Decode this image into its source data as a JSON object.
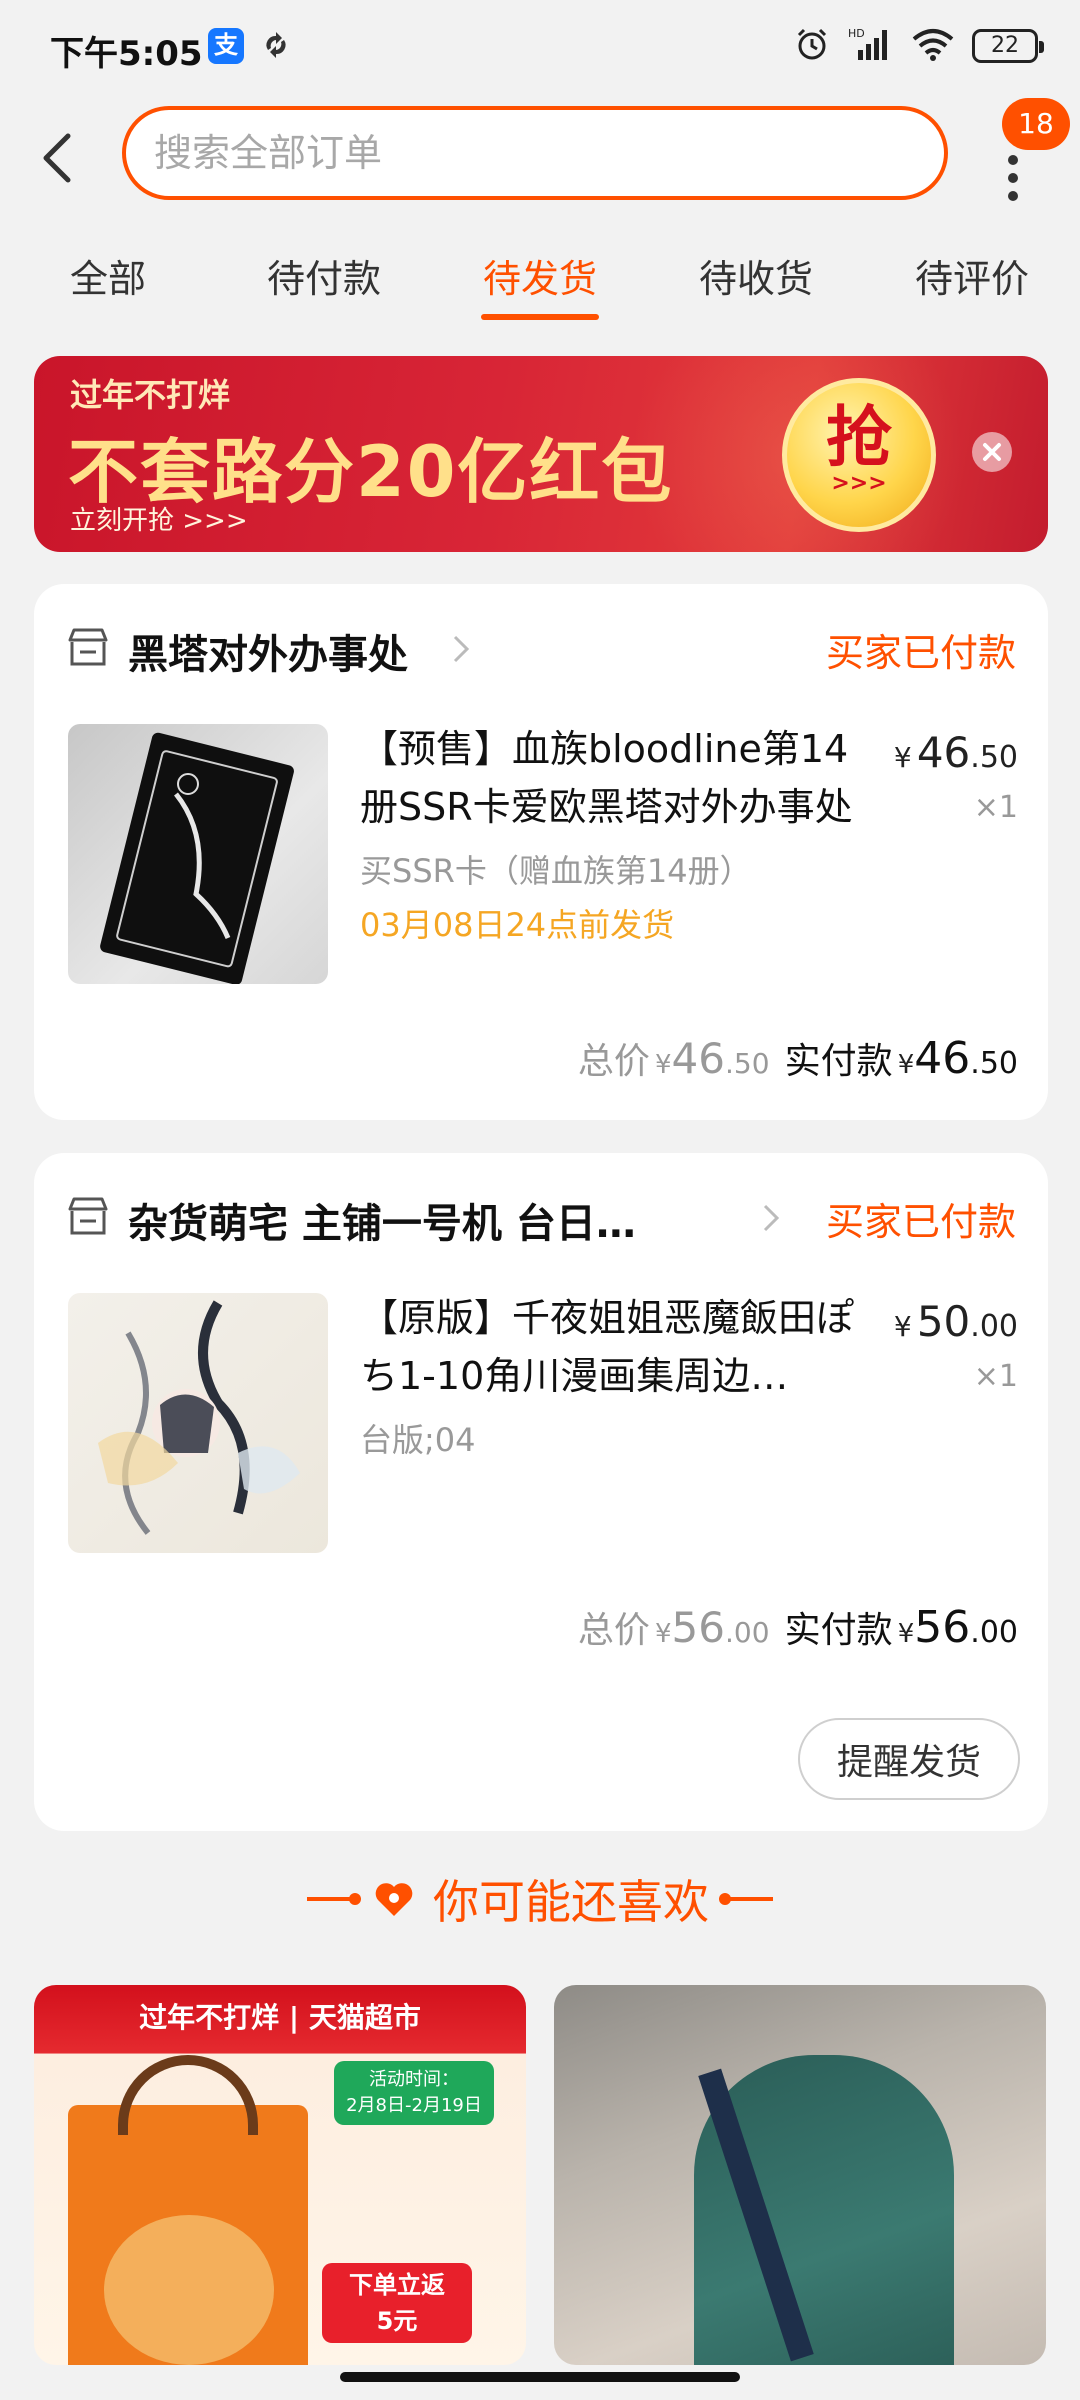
{
  "status_bar": {
    "time": "下午5:05",
    "network": "HD",
    "battery": "22"
  },
  "header": {
    "search_placeholder": "搜索全部订单",
    "message_badge": "18"
  },
  "tabs": [
    {
      "label": "全部"
    },
    {
      "label": "待付款"
    },
    {
      "label": "待发货",
      "active": true
    },
    {
      "label": "待收货"
    },
    {
      "label": "待评价"
    }
  ],
  "banner": {
    "small_text": "过年不打烊",
    "big_text": "不套路分20亿红包",
    "cta_text": "立刻开抢 >>>",
    "button_text": "抢",
    "button_arrows": ">>>"
  },
  "orders": [
    {
      "shop": "黑塔对外办事处",
      "status": "买家已付款",
      "title": "【预售】血族bloodline第14册SSR卡爱欧黑塔对外办事处",
      "spec": "买SSR卡（赠血族第14册）",
      "ship_note": "03月08日24点前发货",
      "price_currency": "¥",
      "price_int": "46",
      "price_dec": ".50",
      "qty": "×1",
      "total_label": "总价",
      "total_int": "46",
      "total_dec": ".50",
      "paid_label": "实付款",
      "paid_int": "46",
      "paid_dec": ".50"
    },
    {
      "shop": "杂货萌宅 主铺一号机 台日…",
      "status": "买家已付款",
      "title": "【原版】千夜姐姐恶魔飯田ぽち1-10角川漫画集周边…",
      "spec": "台版;04",
      "price_currency": "¥",
      "price_int": "50",
      "price_dec": ".00",
      "qty": "×1",
      "total_label": "总价",
      "total_int": "56",
      "total_dec": ".00",
      "paid_label": "实付款",
      "paid_int": "56",
      "paid_dec": ".00",
      "action_button": "提醒发货"
    }
  ],
  "recommend": {
    "title": "你可能还喜欢",
    "card1": {
      "top_text": "过年不打烊 | 天猫超市",
      "time_label": "活动时间：",
      "time_range": "2月8日-2月19日",
      "tag_line1": "下单立返",
      "tag_line2": "5元"
    }
  },
  "colors": {
    "accent": "#ff5000",
    "ship_note": "#f5a623",
    "background": "#f2f2f2"
  }
}
